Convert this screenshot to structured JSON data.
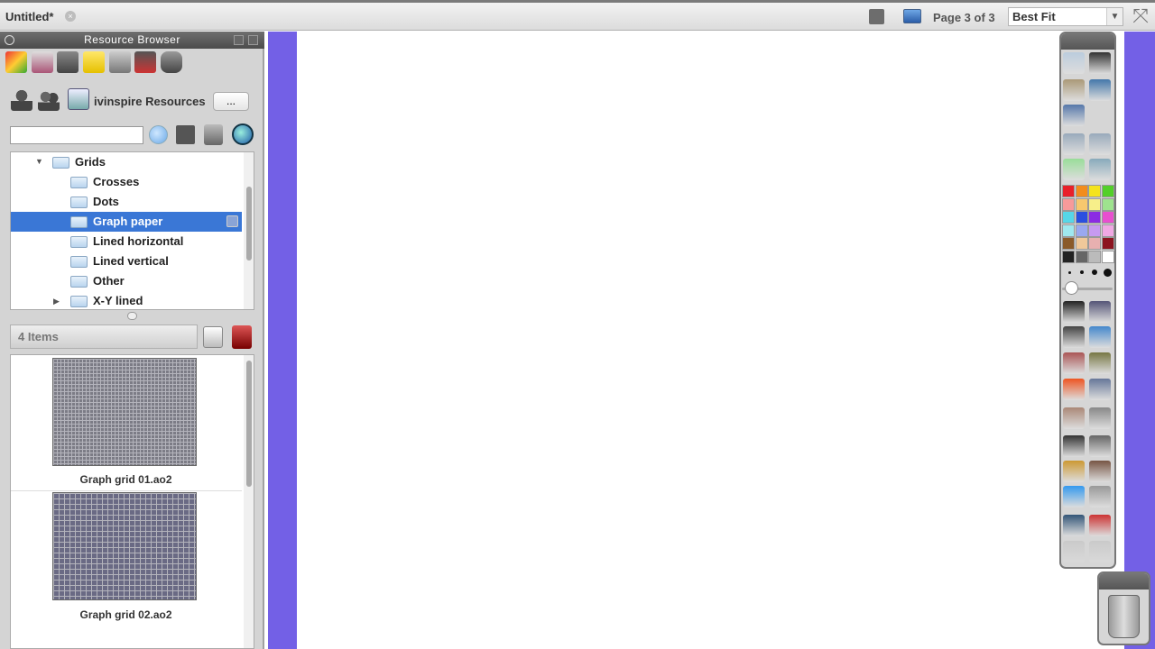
{
  "document": {
    "tab_label": "Untitled*",
    "close_glyph": "×"
  },
  "topbar": {
    "page_indicator": "Page 3 of 3",
    "zoom_value": "Best Fit",
    "zoom_arrow": "▼",
    "fullscreen_glyph": "⤧"
  },
  "resource_browser": {
    "title": "Resource Browser",
    "path_label": "ivinspire Resources",
    "more_button": "...",
    "search_value": "",
    "tree": {
      "root": "Grids",
      "children": [
        "Crosses",
        "Dots",
        "Graph paper",
        "Lined horizontal",
        "Lined vertical",
        "Other",
        "X-Y lined"
      ],
      "selected": "Graph paper"
    },
    "items_count": "4 Items",
    "items": [
      {
        "label": "Graph grid 01.ao2"
      },
      {
        "label": "Graph grid 02.ao2"
      }
    ]
  },
  "toolbox": {
    "colors": [
      "#e8202a",
      "#f28c1d",
      "#f4e31c",
      "#53cf2a",
      "#f79a9a",
      "#f7c86e",
      "#f7ef8a",
      "#9ee38e",
      "#56d7e8",
      "#2a4fe0",
      "#8b2be3",
      "#e84fcf",
      "#9fe8ef",
      "#9aa8f0",
      "#c79af0",
      "#f0a8e3",
      "#8a5a2a",
      "#f0c89a",
      "#e8b0b0",
      "#8c1420",
      "#222222",
      "#666666",
      "#bbbbbb",
      "#ffffff"
    ],
    "pen_sizes": [
      "small",
      "medium",
      "large",
      "x-large"
    ]
  },
  "icons": {
    "rb_top_row": [
      "resource-icon",
      "page-icon",
      "collection-icon",
      "notes-icon",
      "test-icon",
      "stamp-icon",
      "puzzle-icon"
    ],
    "rb_second_row": [
      "user-icon",
      "shared-users-icon",
      "computer-icon"
    ],
    "toolbox_tools": [
      "pages-icon",
      "pi-icon",
      "effects-icon",
      "image-icon",
      "camera-icon",
      "back-icon",
      "forward-icon",
      "record-icon",
      "magic-icon",
      "select-icon",
      "cut-icon",
      "pen-icon",
      "highlighter-icon",
      "eraser-icon",
      "fill-icon",
      "shape-icon",
      "connector-icon",
      "stamp-icon",
      "magic-ink-icon",
      "text-icon",
      "grid-icon",
      "handwriting-icon",
      "keyboard-icon",
      "globe-icon",
      "clone-icon",
      "search-icon",
      "reset-icon",
      "undo-icon",
      "redo-icon"
    ]
  }
}
